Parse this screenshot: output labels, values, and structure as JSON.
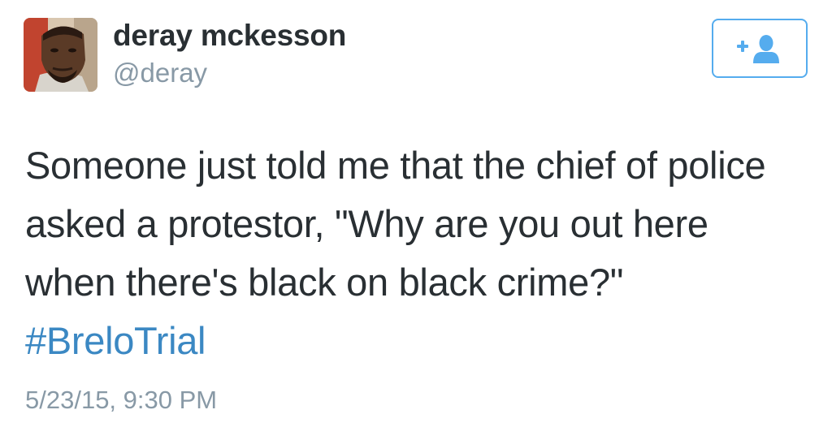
{
  "user": {
    "display_name": "deray mckesson",
    "handle": "@deray"
  },
  "follow_button": {
    "icon": "add-user-icon",
    "color": "#55acee"
  },
  "tweet": {
    "text": "Someone just told me that the chief of police asked a protestor, \"Why are you out here when there's black on black crime?\"",
    "hashtag": "#BreloTrial",
    "hashtag_color": "#3b88c3",
    "timestamp": "5/23/15, 9:30 PM"
  }
}
